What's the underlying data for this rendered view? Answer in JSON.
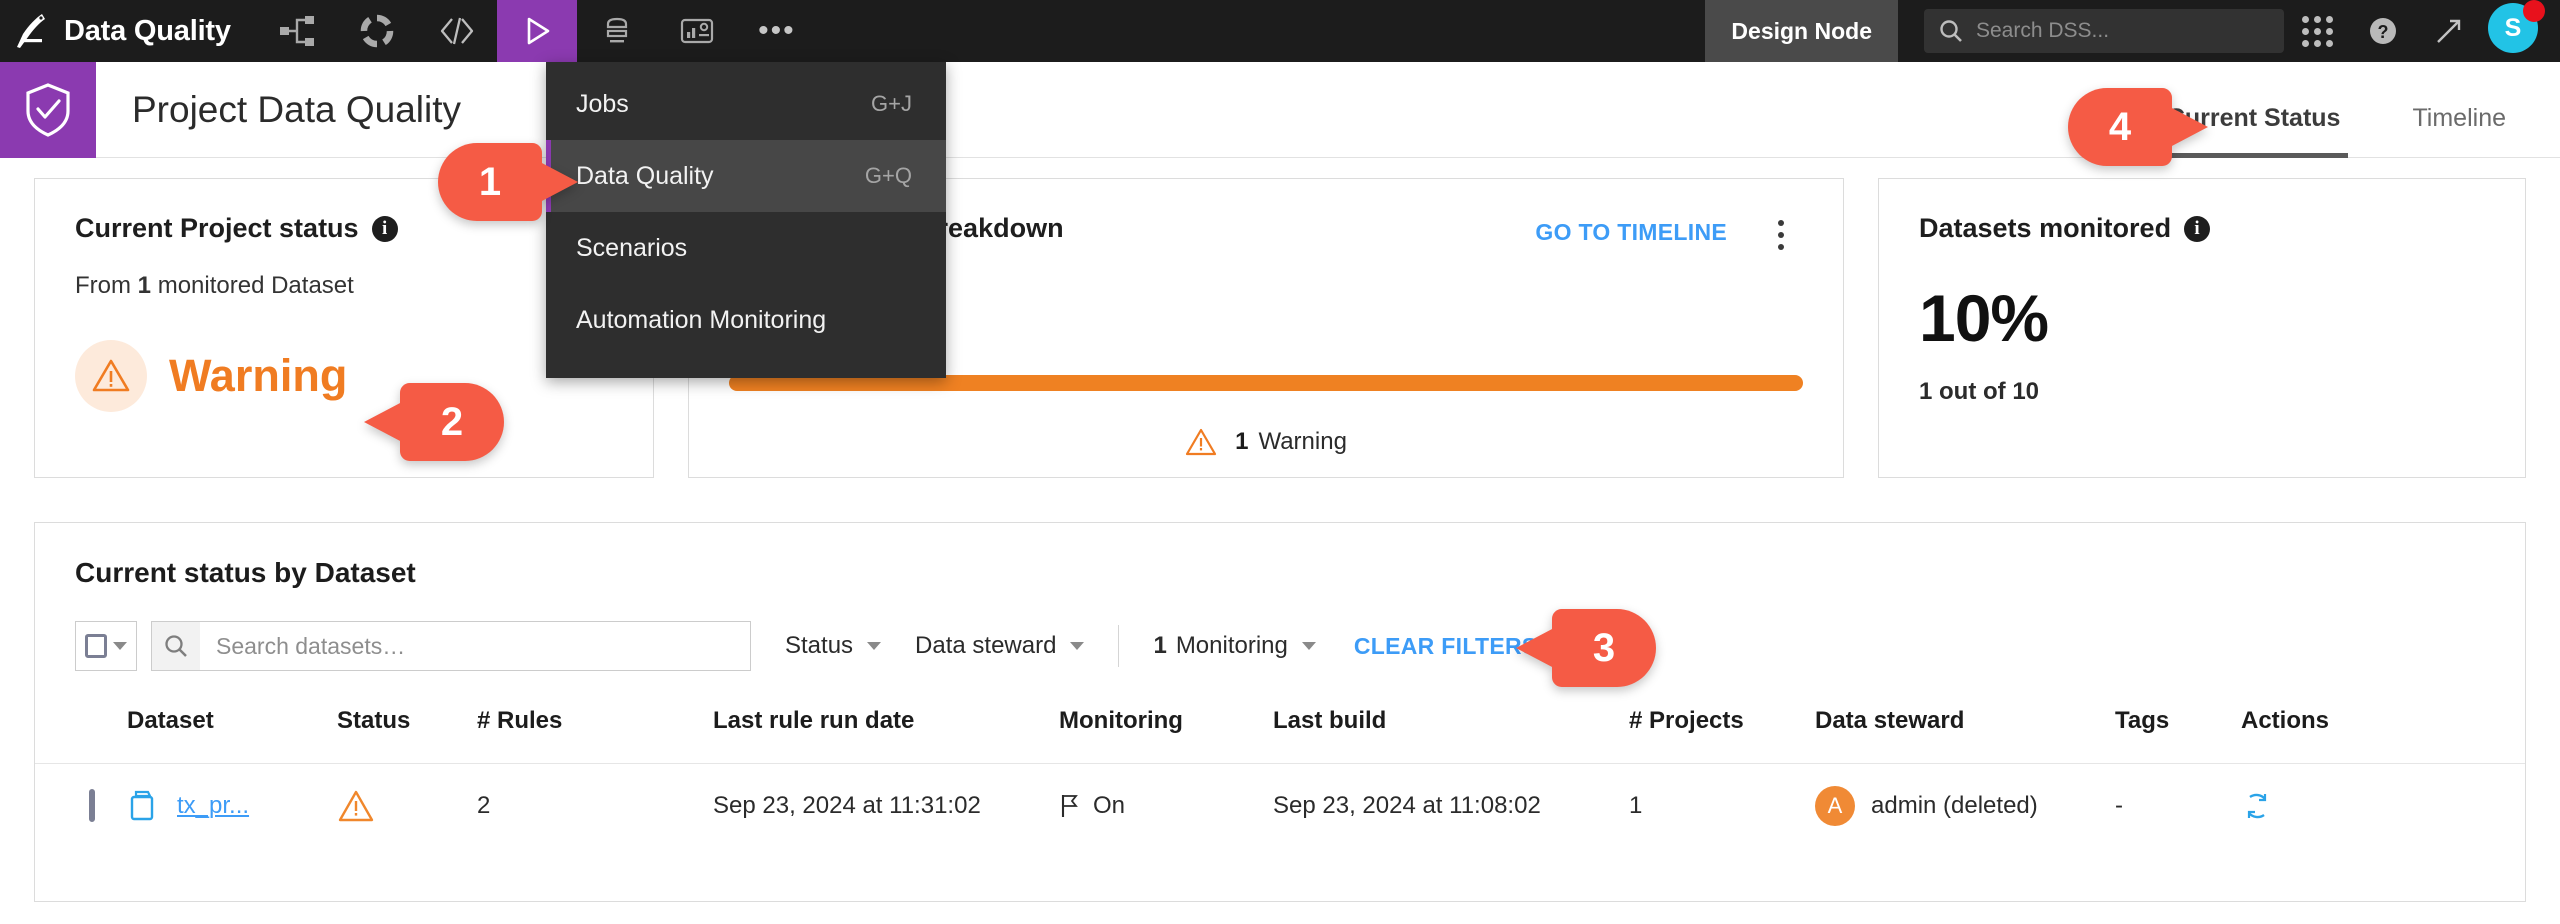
{
  "topnav": {
    "app_title": "Data Quality",
    "logo_icon": "dataiku-bird-logo-icon",
    "icons": [
      {
        "name": "flow-share-icon",
        "active": false
      },
      {
        "name": "lab-donut-icon",
        "active": false
      },
      {
        "name": "code-brackets-icon",
        "active": false
      },
      {
        "name": "play-triangle-icon",
        "active": true
      },
      {
        "name": "automation-stack-icon",
        "active": false
      },
      {
        "name": "dashboard-icon",
        "active": false
      },
      {
        "name": "more-ellipsis-icon",
        "active": false
      }
    ],
    "design_node_label": "Design Node",
    "search": {
      "placeholder": "Search DSS...",
      "value": "",
      "icon": "search-icon"
    },
    "apps_grid_icon": "apps-grid-icon",
    "help_icon": "help-question-icon",
    "trend_icon": "trending-arrow-icon",
    "avatar_initial": "S",
    "notification_color": "#e8111c"
  },
  "dropdown": {
    "items": [
      {
        "label": "Jobs",
        "shortcut": "G+J",
        "selected": false
      },
      {
        "label": "Data Quality",
        "shortcut": "G+Q",
        "selected": true
      },
      {
        "label": "Scenarios",
        "shortcut": "",
        "selected": false
      },
      {
        "label": "Automation Monitoring",
        "shortcut": "",
        "selected": false
      }
    ]
  },
  "project_header": {
    "emblem_icon": "shield-check-icon",
    "title": "Project Data Quality",
    "tabs": [
      {
        "label": "Current Status",
        "active": true
      },
      {
        "label": "Timeline",
        "active": false
      }
    ]
  },
  "cards": {
    "project_status": {
      "title": "Current Project status",
      "info_icon": "info-icon",
      "subtitle_prefix": "From ",
      "subtitle_count": "1",
      "subtitle_suffix": " monitored Dataset",
      "status_label": "Warning",
      "status_icon": "warning-triangle-icon",
      "status_color": "#f07c22"
    },
    "breakdown": {
      "title": "Current status breakdown",
      "link_label": "GO TO TIMELINE",
      "kebab_icon": "kebab-menu-icon",
      "bar_color": "#ef8122",
      "legend_count": "1",
      "legend_label": "Warning",
      "legend_icon": "warning-triangle-icon"
    },
    "datasets_monitored": {
      "title": "Datasets monitored",
      "info_icon": "info-icon",
      "percent": "10%",
      "ratio": "1 out of 10"
    }
  },
  "panel": {
    "title": "Current status by Dataset",
    "filters": {
      "bulk_select_icon": "checkbox-dropdown-icon",
      "search": {
        "placeholder": "Search datasets…",
        "value": "",
        "icon": "search-icon"
      },
      "status_label": "Status",
      "steward_label": "Data steward",
      "monitoring_count": "1",
      "monitoring_label": "Monitoring",
      "clear_filters_label": "CLEAR FILTERS"
    },
    "table": {
      "columns": [
        "",
        "Dataset",
        "Status",
        "# Rules",
        "Last rule run date",
        "Monitoring",
        "Last build",
        "# Projects",
        "Data steward",
        "Tags",
        "Actions"
      ],
      "rows": [
        {
          "dataset": "tx_pr...",
          "dataset_icon": "dataset-folder-icon",
          "status_icon": "warning-triangle-icon",
          "rules": "2",
          "last_rule_run": "Sep 23, 2024 at 11:31:02",
          "monitoring": "On",
          "monitoring_icon": "flag-icon",
          "last_build": "Sep 23, 2024 at 11:08:02",
          "projects": "1",
          "steward_initial": "A",
          "steward": "admin (deleted)",
          "tags": "-",
          "action_icon": "refresh-sync-icon"
        }
      ]
    }
  },
  "callouts": [
    {
      "number": "1",
      "direction": "right"
    },
    {
      "number": "2",
      "direction": "left"
    },
    {
      "number": "3",
      "direction": "left"
    },
    {
      "number": "4",
      "direction": "right"
    }
  ]
}
